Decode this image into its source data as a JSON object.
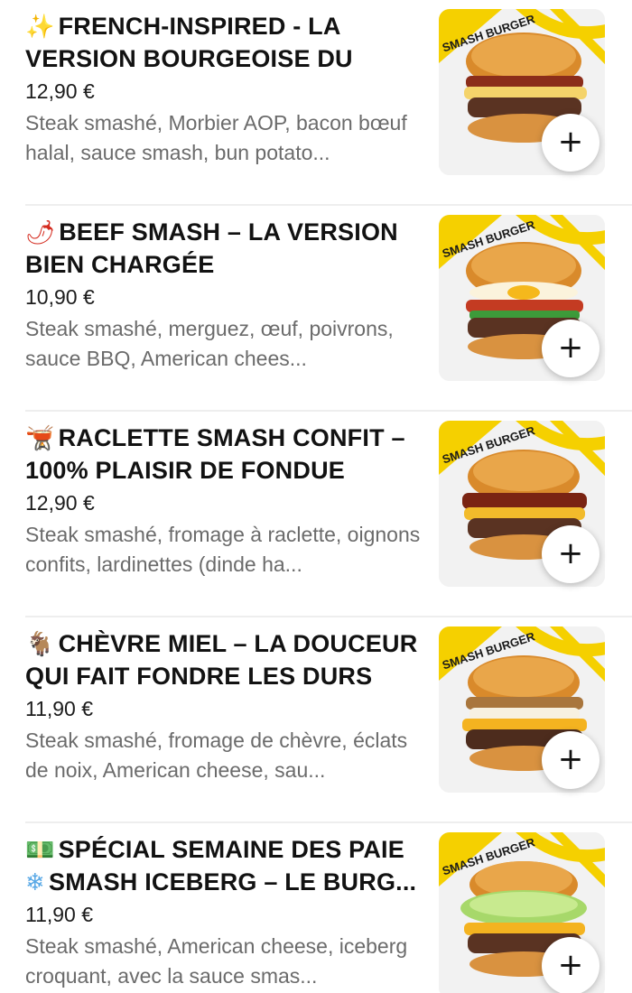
{
  "menu": {
    "items": [
      {
        "emoji": "✨",
        "title": "FRENCH-INSPIRED - LA VERSION BOURGEOISE DU BUR...",
        "price": "12,90 €",
        "description": "Steak smashé, Morbier AOP, bacon bœuf halal, sauce smash, bun potato...",
        "badge": "SMASH BURGER",
        "add_label": "+"
      },
      {
        "emoji": "🌶",
        "title": "BEEF SMASH – LA VERSION BIEN CHARGÉE",
        "price": "10,90 €",
        "description": "Steak smashé, merguez, œuf, poivrons, sauce BBQ, American chees...",
        "badge": "SMASH BURGER",
        "add_label": "+"
      },
      {
        "emoji": "🫕",
        "title": "RACLETTE SMASH CONFIT – 100% PLAISIR DE FONDUE",
        "price": "12,90 €",
        "description": "Steak smashé, fromage à raclette, oignons confits, lardinettes (dinde ha...",
        "badge": "SMASH BURGER",
        "add_label": "+"
      },
      {
        "emoji": "🐐",
        "title": "CHÈVRE MIEL – LA DOUCEUR QUI FAIT FONDRE LES DURS",
        "price": "11,90 €",
        "description": "Steak smashé, fromage de chèvre, éclats de noix, American cheese, sau...",
        "badge": "SMASH BURGER",
        "add_label": "+"
      },
      {
        "emoji": "💵",
        "emoji2": "❄",
        "title": "SPÉCIAL SEMAINE DES PAIE SMASH ICEBERG – LE BURG...",
        "price": "11,90 €",
        "description": "Steak smashé, American cheese, iceberg croquant, avec la sauce smas...",
        "badge": "SMASH BURGER",
        "add_label": "+"
      }
    ]
  }
}
